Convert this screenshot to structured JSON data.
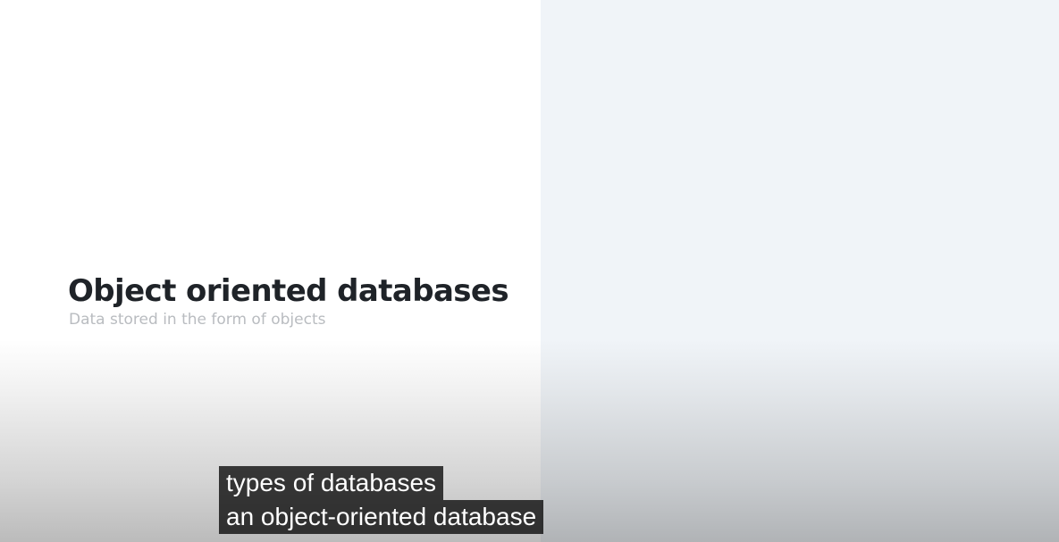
{
  "slide": {
    "title": "Object oriented databases",
    "subtitle": "Data stored in the form of objects"
  },
  "captions": [
    "types of databases",
    "an object-oriented database"
  ],
  "colors": {
    "left_panel": "#ffffff",
    "right_panel": "#f0f4f8",
    "title_text": "#1f2328",
    "subtitle_text": "#b9bcc0",
    "caption_background": "#141414",
    "caption_text": "#ffffff"
  }
}
